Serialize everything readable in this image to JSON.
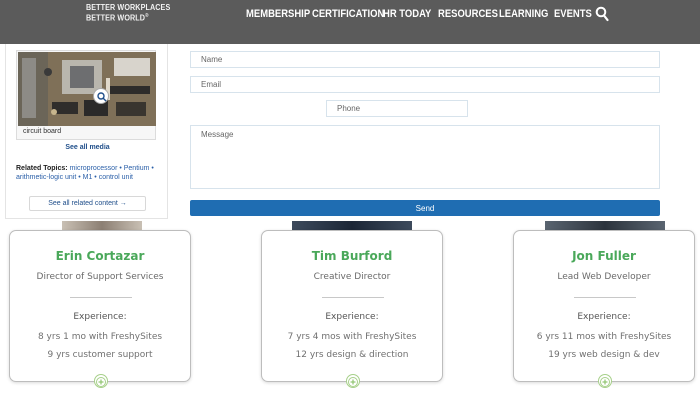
{
  "header": {
    "logo_line1": "BETTER WORKPLACES",
    "logo_line2": "BETTER WORLD",
    "logo_mark": "®",
    "nav": [
      "MEMBERSHIP",
      "CERTIFICATION",
      "HR TODAY",
      "RESOURCES",
      "LEARNING",
      "EVENTS"
    ],
    "search_icon": "search-icon",
    "bg_color": "#5b5b5b"
  },
  "sidebar": {
    "image_caption": "circuit board",
    "zoom_icon": "zoom-icon",
    "see_all_media": "See all media",
    "related_label": "Related Topics:",
    "related_topics": "microprocessor • Pentium • arithmetic-logic unit • M1 • control unit",
    "see_related": "See all related content →"
  },
  "form": {
    "name_placeholder": "Name",
    "email_placeholder": "Email",
    "phone_placeholder": "Phone",
    "message_placeholder": "Message",
    "send_label": "Send",
    "accent_color": "#1f6db2"
  },
  "team": [
    {
      "name": "Erin Cortazar",
      "role": "Director of Support Services",
      "exp_label": "Experience:",
      "exp_1": "8 yrs 1 mo with FreshySites",
      "exp_2": "9 yrs customer support"
    },
    {
      "name": "Tim Burford",
      "role": "Creative Director",
      "exp_label": "Experience:",
      "exp_1": "7 yrs 4 mos with FreshySites",
      "exp_2": "12 yrs design & direction"
    },
    {
      "name": "Jon Fuller",
      "role": "Lead Web Developer",
      "exp_label": "Experience:",
      "exp_1": "6 yrs 11 mos with FreshySites",
      "exp_2": "19 yrs web design & dev"
    }
  ],
  "colors": {
    "name_green": "#4aa85a",
    "link_blue": "#2a5fa8"
  }
}
